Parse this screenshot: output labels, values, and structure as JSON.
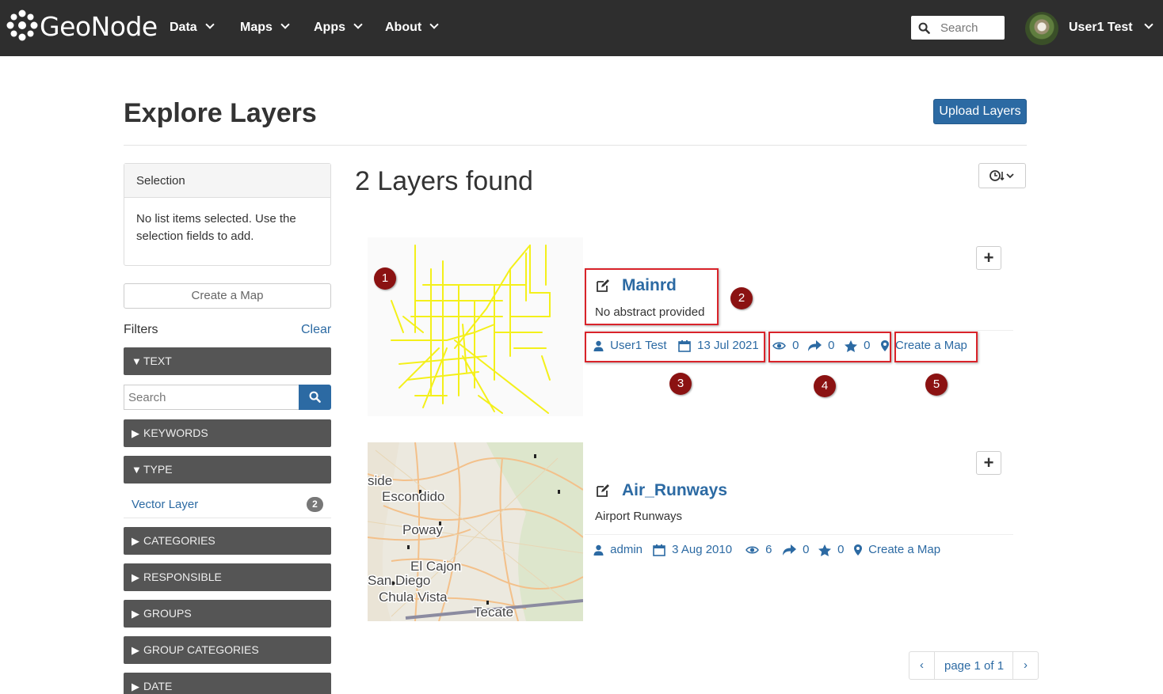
{
  "header": {
    "brand": "GeoNode",
    "menus": [
      "Data",
      "Maps",
      "Apps",
      "About"
    ],
    "search_placeholder": "Search",
    "user_name": "User1 Test"
  },
  "page": {
    "title": "Explore Layers",
    "upload_label": "Upload Layers",
    "results_label": "2 Layers found"
  },
  "sidebar": {
    "selection_title": "Selection",
    "selection_text": "No list items selected. Use the selection fields to add.",
    "create_map_label": "Create a Map",
    "filters_label": "Filters",
    "clear_label": "Clear",
    "text_filter": "TEXT",
    "search_placeholder": "Search",
    "keywords": "KEYWORDS",
    "type": "TYPE",
    "type_option": {
      "label": "Vector Layer",
      "count": "2"
    },
    "categories": "CATEGORIES",
    "responsible": "RESPONSIBLE",
    "groups": "GROUPS",
    "group_categories": "GROUP CATEGORIES",
    "date": "DATE"
  },
  "layers": [
    {
      "title": "Mainrd",
      "abstract": "No abstract provided",
      "owner": "User1 Test",
      "date": "13 Jul 2021",
      "views": "0",
      "shares": "0",
      "ratings": "0",
      "create_map": "Create a Map"
    },
    {
      "title": "Air_Runways",
      "abstract": "Airport Runways",
      "owner": "admin",
      "date": "3 Aug 2010",
      "views": "6",
      "shares": "0",
      "ratings": "0",
      "create_map": "Create a Map"
    }
  ],
  "map_labels": [
    "side",
    "Escondido",
    "Poway",
    "El Cajon",
    "San Diego",
    "Chula Vista",
    "Tecate"
  ],
  "annotations": [
    "1",
    "2",
    "3",
    "4",
    "5"
  ],
  "pagination": {
    "label": "page 1 of 1",
    "prev": "‹",
    "next": "›"
  },
  "colors": {
    "navbar": "#2e2e2e",
    "accent": "#2c6aa3",
    "filter_bar": "#555555",
    "marker": "#8b1212",
    "highlight": "#d9232a",
    "roads": "#f4f01a"
  }
}
